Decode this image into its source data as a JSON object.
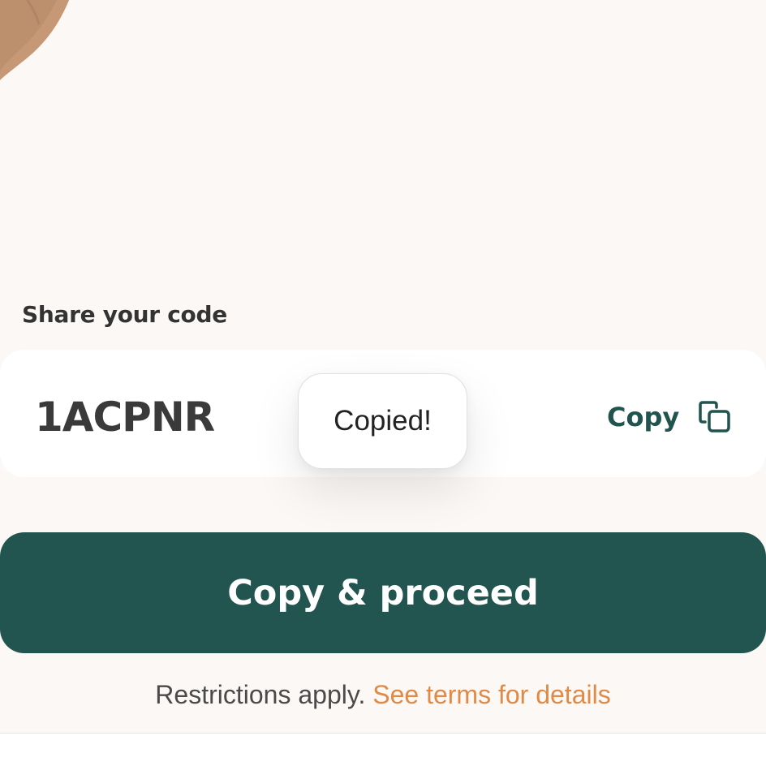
{
  "share": {
    "label": "Share your code",
    "code": "1ACPNR",
    "copy_label": "Copy",
    "copy_icon": "copy-icon"
  },
  "toast": {
    "text": "Copied!"
  },
  "primary_action": {
    "label": "Copy & proceed"
  },
  "footnote": {
    "text": "Restrictions apply.",
    "link_text": "See terms for details"
  },
  "colors": {
    "background": "#fcf8f6",
    "accent_green": "#225450",
    "link_orange": "#e08a47",
    "text_dark": "#333333"
  }
}
